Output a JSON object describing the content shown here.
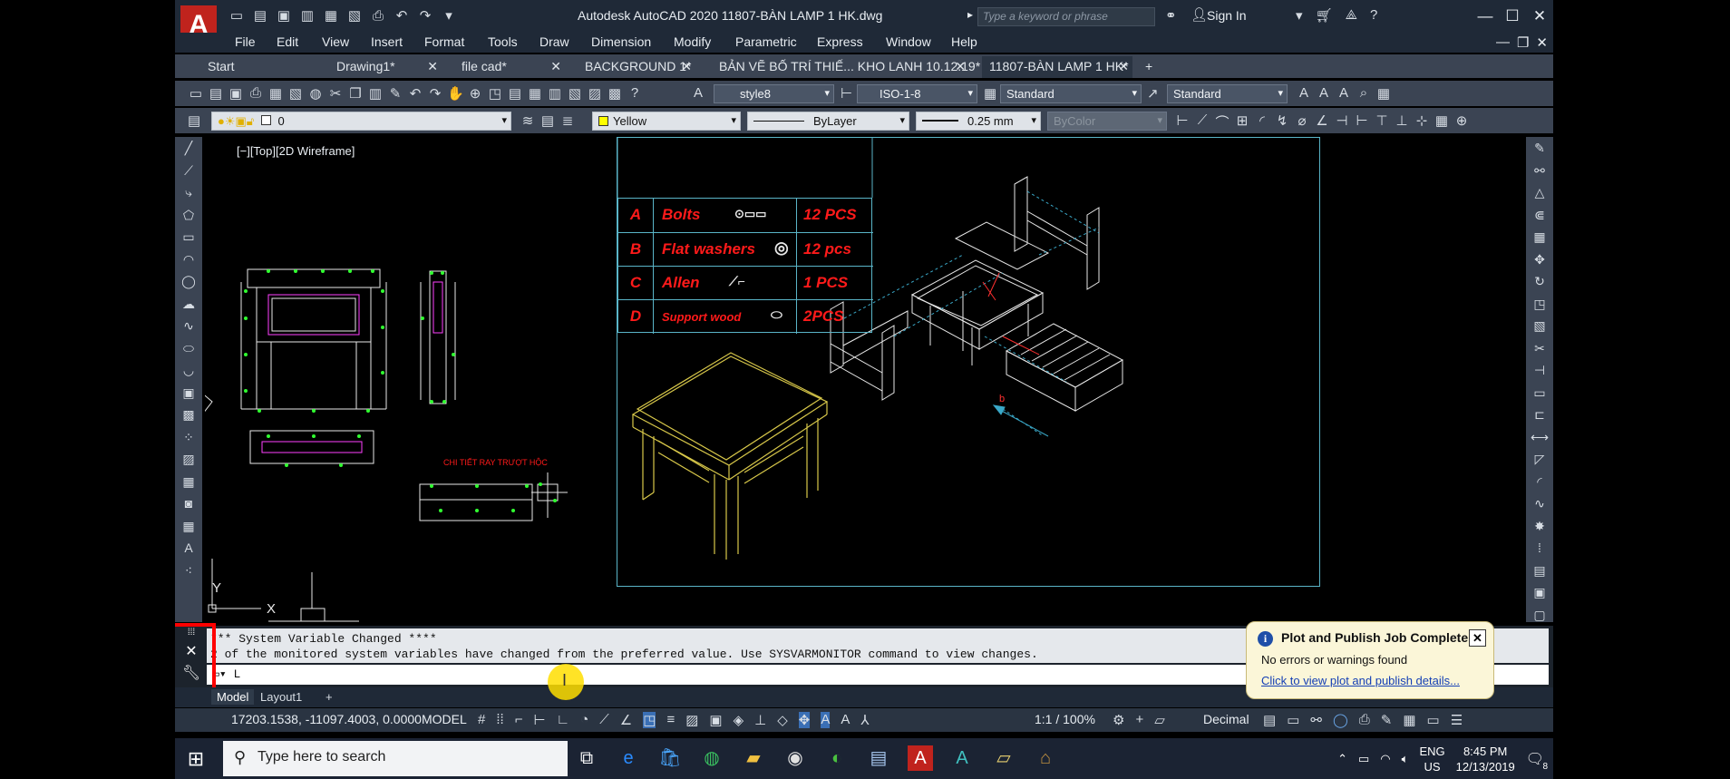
{
  "app": {
    "title": "Autodesk AutoCAD 2020    11807-BÀN LAMP 1 HK.dwg",
    "logo_letter": "A",
    "search_placeholder": "Type a keyword or phrase",
    "sign_in": "Sign In"
  },
  "menu": [
    "File",
    "Edit",
    "View",
    "Insert",
    "Format",
    "Tools",
    "Draw",
    "Dimension",
    "Modify",
    "Parametric",
    "Express",
    "Window",
    "Help"
  ],
  "tabs": [
    {
      "label": "Start",
      "closable": false
    },
    {
      "label": "Drawing1*",
      "closable": true
    },
    {
      "label": "file cad*",
      "closable": true
    },
    {
      "label": "BACKGROUND 1*",
      "closable": true
    },
    {
      "label": "BẢN VẼ BỐ TRÍ THIẾ... KHO LANH 10.12.19*",
      "closable": true
    },
    {
      "label": "11807-BÀN LAMP 1 HK*",
      "closable": true,
      "active": true
    }
  ],
  "toolbar": {
    "text_style": "style8",
    "dim_style": "ISO-1-8",
    "table_style": "Standard",
    "multileader_style": "Standard",
    "layer": "0",
    "color": "Yellow",
    "color_swatch": "#ffff00",
    "linetype": "ByLayer",
    "lineweight": "0.25 mm",
    "plotstyle": "ByColor"
  },
  "viewport": {
    "label": "[−][Top][2D Wireframe]",
    "ucs_y": "Y",
    "ucs_x": "X",
    "note": "CHI TIẾT RAY TRƯỢT HỘC",
    "detail_letter": "b"
  },
  "bom": [
    {
      "key": "A",
      "name": "Bolts",
      "qty": "12 PCS"
    },
    {
      "key": "B",
      "name": "Flat washers",
      "qty": "12 pcs"
    },
    {
      "key": "C",
      "name": "Allen",
      "qty": "1 PCS"
    },
    {
      "key": "D",
      "name": "Support wood",
      "qty": "2PCS"
    }
  ],
  "command": {
    "history_line1": "*** System Variable Changed ****",
    "history_line2": "2 of the monitored system variables have changed from the preferred value. Use SYSVARMONITOR command to view changes.",
    "input": "L"
  },
  "layout_tabs": [
    "Model",
    "Layout1"
  ],
  "status": {
    "coords": "17203.1538, -11097.4003, 0.0000",
    "mode": "MODEL",
    "scale": "1:1 / 100%",
    "units": "Decimal"
  },
  "notification": {
    "title": "Plot and Publish Job Complete",
    "message": "No errors or warnings found",
    "link": "Click to view plot and publish details..."
  },
  "taskbar": {
    "search": "Type here to search",
    "lang1": "ENG",
    "lang2": "US",
    "time": "8:45 PM",
    "date": "12/13/2019",
    "notif_count": "8"
  }
}
